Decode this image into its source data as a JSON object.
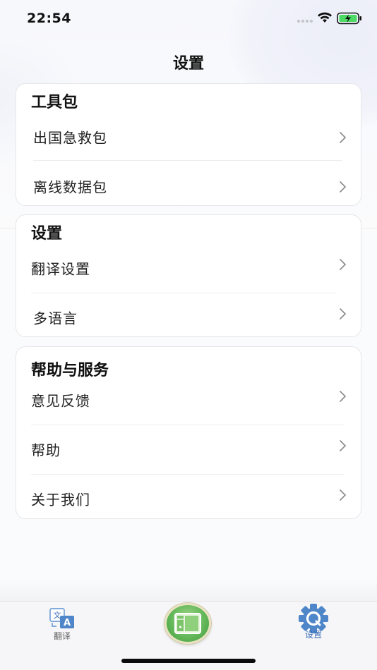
{
  "status_bar": {
    "time": "22:54"
  },
  "page": {
    "title": "设置"
  },
  "sections": [
    {
      "title": "工具包",
      "items": [
        {
          "label": "出国急救包"
        },
        {
          "label": "离线数据包"
        }
      ]
    },
    {
      "title": "设置",
      "items": [
        {
          "label": "翻译设置"
        },
        {
          "label": "多语言"
        }
      ]
    },
    {
      "title": "帮助与服务",
      "items": [
        {
          "label": "意见反馈"
        },
        {
          "label": "帮助"
        },
        {
          "label": "关于我们"
        }
      ]
    }
  ],
  "tab_bar": {
    "tabs": [
      {
        "label": "翻译",
        "icon": "translate-icon",
        "active": false
      },
      {
        "label": "",
        "icon": "scan-center-icon",
        "active": false
      },
      {
        "label": "设置",
        "icon": "gear-icon",
        "active": true
      }
    ]
  },
  "colors": {
    "accent": "#3c6fb6",
    "center_button": "#64b85a",
    "battery": "#4cd964"
  }
}
